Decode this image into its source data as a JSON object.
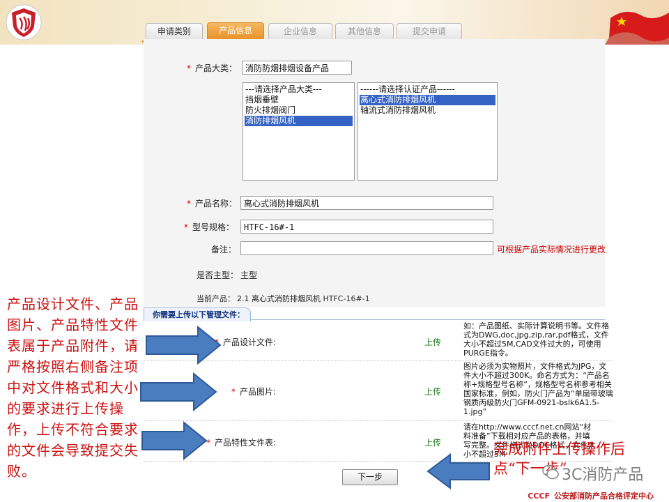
{
  "tabs": [
    {
      "label": "申请类别",
      "state": "done"
    },
    {
      "label": "产品信息",
      "state": "active"
    },
    {
      "label": "企业信息",
      "state": "disabled"
    },
    {
      "label": "其他信息",
      "state": "disabled"
    },
    {
      "label": "提交申请",
      "state": "disabled"
    }
  ],
  "form": {
    "category_label": "产品大类：",
    "category_value": "消防防烟排烟设备产品",
    "product_types": {
      "header": "---请选择产品大类---",
      "options": [
        "挡烟垂壁",
        "防火排烟阀门",
        "消防排烟风机"
      ],
      "selected_index": 2
    },
    "cert_products": {
      "header": "------请选择认证产品------",
      "options": [
        "离心式消防排烟风机",
        "轴流式消防排烟风机"
      ],
      "selected_index": 0
    },
    "name_label": "产品名称：",
    "name_value": "离心式消防排烟风机",
    "model_label": "型号规格：",
    "model_value": "HTFC-16#-1",
    "remark_label": "备注：",
    "remark_value": "",
    "remark_hint": "可根据产品实际情况进行更改",
    "main_type_label": "是否主型：",
    "main_type_value": "主型",
    "current_label": "当前产品：",
    "current_value": "2.1 离心式消防排烟风机 HTFC-16#-1",
    "required_mark": "*"
  },
  "upload": {
    "section_title": "你需要上传以下管理文件：",
    "rows": [
      {
        "label": "产品设计文件:",
        "action": "上传",
        "note": "如：产品图纸、实际计算说明书等。文件格式为DWG,doc,jpg,zip,rar,pdf格式，文件大小不超过5M,CAD文件过大的，可使用PURGE指令。"
      },
      {
        "label": "产品图片:",
        "action": "上传",
        "note": "图片必须为实物照片，文件格式为JPG，文件大小不超过300K。命名方式为：“产品名称+规格型号名称”，规格型号名称参考相关国家标准，例如，防火门产品为“单扇带玻璃钢质丙级防火门GFM-0921-bslk6A1.5-1.jpg”"
      },
      {
        "label": "产品特性文件表:",
        "action": "上传",
        "note": "请在http://www.cccf.net.cn网站“材料准备”下载相对应产品的表格，并填写完整。文件格式为DOC格式，文件大小不超过5M"
      }
    ],
    "next_button": "下一步"
  },
  "annotations": {
    "left": "产品设计文件、产品图片、产品特性文件表属于产品附件，请严格按照右侧备注项中对文件格式和大小的要求进行上传操作，上传不符合要求的文件会导致提交失败。",
    "right": "完成附件上传操作后点“下一步”"
  },
  "watermark": "3C消防产品",
  "footer": {
    "brand": "CCCF",
    "org": "公安部消防产品合格评定中心"
  },
  "colors": {
    "accent_tab": "#e8922a",
    "annotation_red": "#cc1111",
    "selection_blue": "#3563c4",
    "arrow_blue": "#4a7cc0",
    "upload_link_green": "#1a7a1a"
  }
}
